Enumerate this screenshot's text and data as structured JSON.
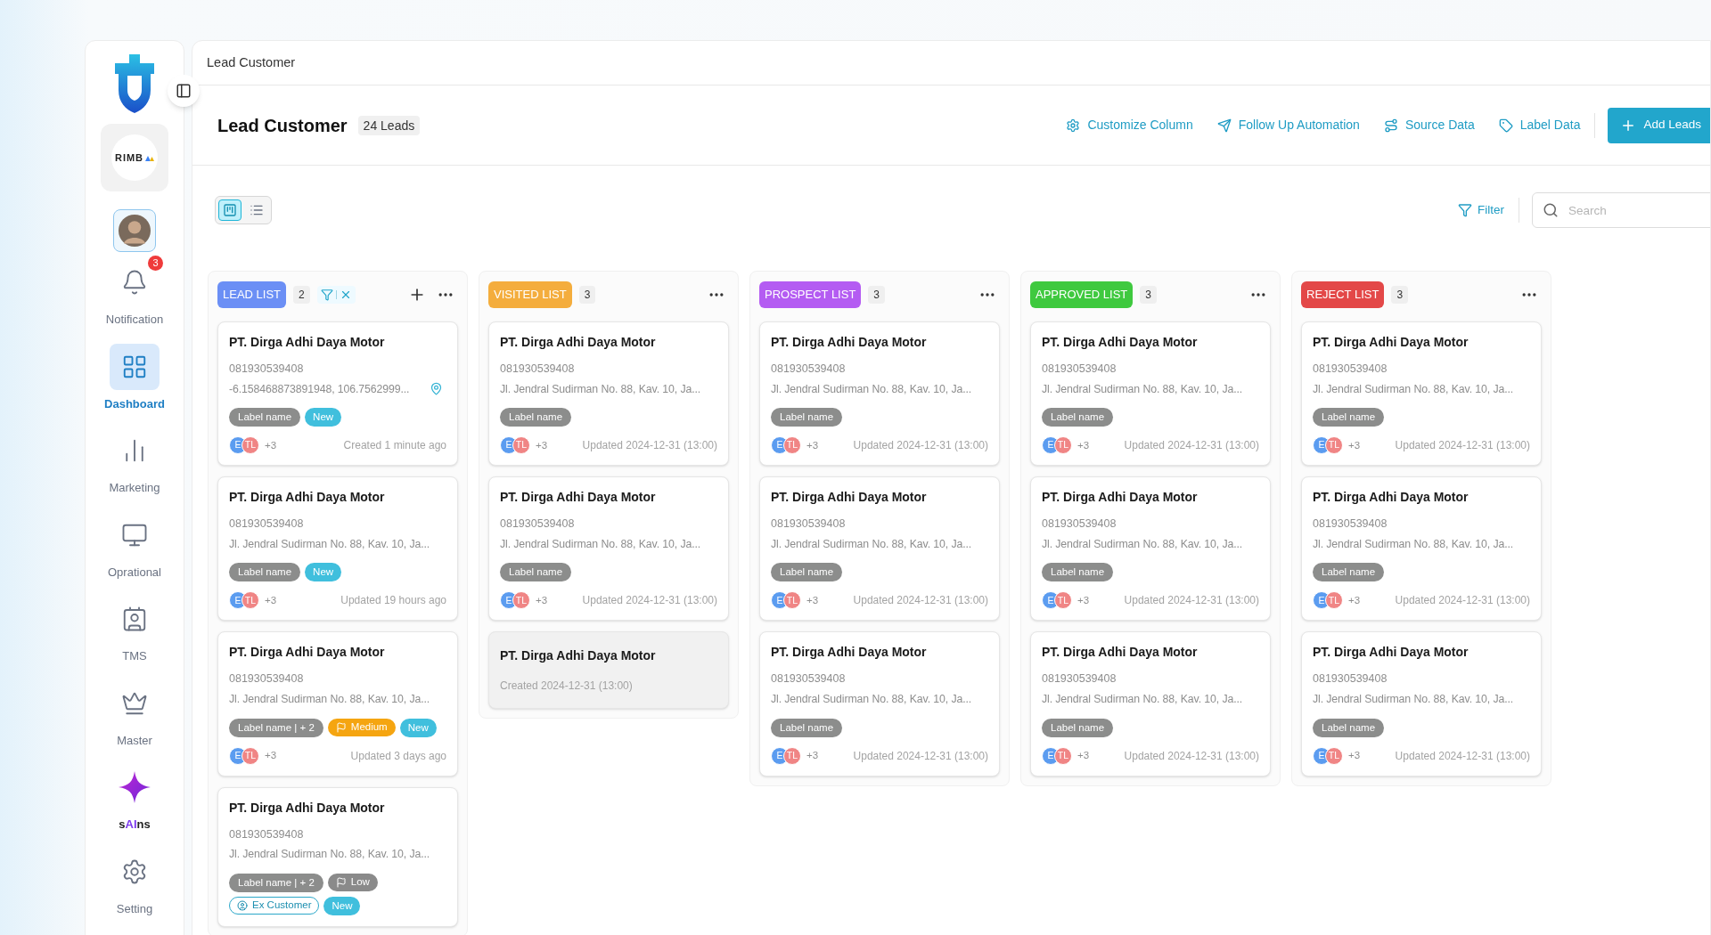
{
  "sidebar": {
    "company": "RIMB",
    "items": [
      {
        "kind": "notification",
        "label": "Notification",
        "selected": false,
        "badge": "3"
      },
      {
        "kind": "dashboard",
        "label": "Dashboard",
        "selected": true
      },
      {
        "kind": "marketing",
        "label": "Marketing",
        "selected": false
      },
      {
        "kind": "operational",
        "label": "Oprational",
        "selected": false
      },
      {
        "kind": "tms",
        "label": "TMS",
        "selected": false
      },
      {
        "kind": "master",
        "label": "Master",
        "selected": false
      },
      {
        "kind": "ai",
        "label": "s**AI**ns",
        "selected": false
      },
      {
        "kind": "setting",
        "label": "Setting",
        "selected": false
      }
    ]
  },
  "breadcrumb": "Lead Customer",
  "header": {
    "title": "Lead Customer",
    "count": "24 Leads",
    "actions": [
      {
        "kind": "customize",
        "label": "Customize Column"
      },
      {
        "kind": "automation",
        "label": "Follow Up Automation"
      },
      {
        "kind": "source",
        "label": "Source Data"
      },
      {
        "kind": "label",
        "label": "Label Data"
      }
    ],
    "primary": "Add Leads"
  },
  "views": [
    {
      "kind": "kanban",
      "selected": true
    },
    {
      "kind": "table",
      "selected": false
    }
  ],
  "filter": "Filter",
  "search": {
    "placeholder": "Search"
  },
  "columns": [
    {
      "title": "LEAD LIST",
      "color": "#6b8ff5",
      "count": "2",
      "filter_active": true,
      "can_add": true,
      "cards": [
        {
          "kind": "full",
          "name": "PT. Dirga Adhi Daya Motor",
          "phone": "081930539408",
          "address": "-6.158468873891948, 106.7562999...",
          "pin": true,
          "tags": [
            {
              "kind": "label",
              "text": "Label name"
            },
            {
              "kind": "status",
              "text": "New"
            }
          ],
          "avatars": [
            {
              "text": "E",
              "color": "#5b9cf0"
            },
            {
              "text": "TL",
              "color": "#f08585"
            }
          ],
          "more": "+3",
          "time": "Created 1 minute ago"
        },
        {
          "kind": "full",
          "name": "PT. Dirga Adhi Daya Motor",
          "phone": "081930539408",
          "address": "Jl. Jendral Sudirman No. 88, Kav. 10, Ja...",
          "pin": false,
          "tags": [
            {
              "kind": "label",
              "text": "Label name"
            },
            {
              "kind": "status",
              "text": "New"
            }
          ],
          "avatars": [
            {
              "text": "E",
              "color": "#5b9cf0"
            },
            {
              "text": "TL",
              "color": "#f08585"
            }
          ],
          "more": "+3",
          "time": "Updated 19 hours ago"
        },
        {
          "kind": "full",
          "name": "PT. Dirga Adhi Daya Motor",
          "phone": "081930539408",
          "address": "Jl. Jendral Sudirman No. 88, Kav. 10, Ja...",
          "pin": false,
          "tags": [
            {
              "kind": "label",
              "text": "Label name | + 2"
            },
            {
              "kind": "priority",
              "text": "Medium",
              "color": "#f5a511"
            },
            {
              "kind": "status",
              "text": "New"
            }
          ],
          "avatars": [
            {
              "text": "E",
              "color": "#5b9cf0"
            },
            {
              "text": "TL",
              "color": "#f08585"
            }
          ],
          "more": "+3",
          "time": "Updated 3 days ago"
        },
        {
          "kind": "full",
          "name": "PT. Dirga Adhi Daya Motor",
          "phone": "081930539408",
          "address": "Jl. Jendral Sudirman No. 88, Kav. 10, Ja...",
          "pin": false,
          "tags": [
            {
              "kind": "label",
              "text": "Label name | + 2"
            },
            {
              "kind": "priority",
              "text": "Low",
              "color": "#8a8a8a"
            },
            {
              "kind": "customer",
              "text": "Ex Customer"
            },
            {
              "kind": "status",
              "text": "New"
            }
          ]
        }
      ]
    },
    {
      "title": "VISITED LIST",
      "color": "#f4ad3d",
      "count": "3",
      "filter_active": false,
      "can_add": false,
      "cards": [
        {
          "kind": "full",
          "name": "PT. Dirga Adhi Daya Motor",
          "phone": "081930539408",
          "address": "Jl. Jendral Sudirman No. 88, Kav. 10, Ja...",
          "pin": false,
          "tags": [
            {
              "kind": "label",
              "text": "Label name"
            }
          ],
          "avatars": [
            {
              "text": "E",
              "color": "#5b9cf0"
            },
            {
              "text": "TL",
              "color": "#f08585"
            }
          ],
          "more": "+3",
          "time": "Updated 2024-12-31 (13:00)"
        },
        {
          "kind": "full",
          "name": "PT. Dirga Adhi Daya Motor",
          "phone": "081930539408",
          "address": "Jl. Jendral Sudirman No. 88, Kav. 10, Ja...",
          "pin": false,
          "tags": [
            {
              "kind": "label",
              "text": "Label name"
            }
          ],
          "avatars": [
            {
              "text": "E",
              "color": "#5b9cf0"
            },
            {
              "text": "TL",
              "color": "#f08585"
            }
          ],
          "more": "+3",
          "time": "Updated 2024-12-31 (13:00)"
        },
        {
          "kind": "compact",
          "name": "PT. Dirga Adhi Daya Motor",
          "time": "Created 2024-12-31 (13:00)"
        }
      ]
    },
    {
      "title": "PROSPECT LIST",
      "color": "#b45cf2",
      "count": "3",
      "filter_active": false,
      "can_add": false,
      "cards": [
        {
          "kind": "full",
          "name": "PT. Dirga Adhi Daya Motor",
          "phone": "081930539408",
          "address": "Jl. Jendral Sudirman No. 88, Kav. 10, Ja...",
          "pin": false,
          "tags": [
            {
              "kind": "label",
              "text": "Label name"
            }
          ],
          "avatars": [
            {
              "text": "E",
              "color": "#5b9cf0"
            },
            {
              "text": "TL",
              "color": "#f08585"
            }
          ],
          "more": "+3",
          "time": "Updated 2024-12-31 (13:00)"
        },
        {
          "kind": "full",
          "name": "PT. Dirga Adhi Daya Motor",
          "phone": "081930539408",
          "address": "Jl. Jendral Sudirman No. 88, Kav. 10, Ja...",
          "pin": false,
          "tags": [
            {
              "kind": "label",
              "text": "Label name"
            }
          ],
          "avatars": [
            {
              "text": "E",
              "color": "#5b9cf0"
            },
            {
              "text": "TL",
              "color": "#f08585"
            }
          ],
          "more": "+3",
          "time": "Updated 2024-12-31 (13:00)"
        },
        {
          "kind": "full",
          "name": "PT. Dirga Adhi Daya Motor",
          "phone": "081930539408",
          "address": "Jl. Jendral Sudirman No. 88, Kav. 10, Ja...",
          "pin": false,
          "tags": [
            {
              "kind": "label",
              "text": "Label name"
            }
          ],
          "avatars": [
            {
              "text": "E",
              "color": "#5b9cf0"
            },
            {
              "text": "TL",
              "color": "#f08585"
            }
          ],
          "more": "+3",
          "time": "Updated 2024-12-31 (13:00)"
        }
      ]
    },
    {
      "title": "APPROVED LIST",
      "color": "#3fc93f",
      "count": "3",
      "filter_active": false,
      "can_add": false,
      "cards": [
        {
          "kind": "full",
          "name": "PT. Dirga Adhi Daya Motor",
          "phone": "081930539408",
          "address": "Jl. Jendral Sudirman No. 88, Kav. 10, Ja...",
          "pin": false,
          "tags": [
            {
              "kind": "label",
              "text": "Label name"
            }
          ],
          "avatars": [
            {
              "text": "E",
              "color": "#5b9cf0"
            },
            {
              "text": "TL",
              "color": "#f08585"
            }
          ],
          "more": "+3",
          "time": "Updated 2024-12-31 (13:00)"
        },
        {
          "kind": "full",
          "name": "PT. Dirga Adhi Daya Motor",
          "phone": "081930539408",
          "address": "Jl. Jendral Sudirman No. 88, Kav. 10, Ja...",
          "pin": false,
          "tags": [
            {
              "kind": "label",
              "text": "Label name"
            }
          ],
          "avatars": [
            {
              "text": "E",
              "color": "#5b9cf0"
            },
            {
              "text": "TL",
              "color": "#f08585"
            }
          ],
          "more": "+3",
          "time": "Updated 2024-12-31 (13:00)"
        },
        {
          "kind": "full",
          "name": "PT. Dirga Adhi Daya Motor",
          "phone": "081930539408",
          "address": "Jl. Jendral Sudirman No. 88, Kav. 10, Ja...",
          "pin": false,
          "tags": [
            {
              "kind": "label",
              "text": "Label name"
            }
          ],
          "avatars": [
            {
              "text": "E",
              "color": "#5b9cf0"
            },
            {
              "text": "TL",
              "color": "#f08585"
            }
          ],
          "more": "+3",
          "time": "Updated 2024-12-31 (13:00)"
        }
      ]
    },
    {
      "title": "REJECT LIST",
      "color": "#e34848",
      "count": "3",
      "filter_active": false,
      "can_add": false,
      "cards": [
        {
          "kind": "full",
          "name": "PT. Dirga Adhi Daya Motor",
          "phone": "081930539408",
          "address": "Jl. Jendral Sudirman No. 88, Kav. 10, Ja...",
          "pin": false,
          "tags": [
            {
              "kind": "label",
              "text": "Label name"
            }
          ],
          "avatars": [
            {
              "text": "E",
              "color": "#5b9cf0"
            },
            {
              "text": "TL",
              "color": "#f08585"
            }
          ],
          "more": "+3",
          "time": "Updated 2024-12-31 (13:00)"
        },
        {
          "kind": "full",
          "name": "PT. Dirga Adhi Daya Motor",
          "phone": "081930539408",
          "address": "Jl. Jendral Sudirman No. 88, Kav. 10, Ja...",
          "pin": false,
          "tags": [
            {
              "kind": "label",
              "text": "Label name"
            }
          ],
          "avatars": [
            {
              "text": "E",
              "color": "#5b9cf0"
            },
            {
              "text": "TL",
              "color": "#f08585"
            }
          ],
          "more": "+3",
          "time": "Updated 2024-12-31 (13:00)"
        },
        {
          "kind": "full",
          "name": "PT. Dirga Adhi Daya Motor",
          "phone": "081930539408",
          "address": "Jl. Jendral Sudirman No. 88, Kav. 10, Ja...",
          "pin": false,
          "tags": [
            {
              "kind": "label",
              "text": "Label name"
            }
          ],
          "avatars": [
            {
              "text": "E",
              "color": "#5b9cf0"
            },
            {
              "text": "TL",
              "color": "#f08585"
            }
          ],
          "more": "+3",
          "time": "Updated 2024-12-31 (13:00)"
        }
      ]
    }
  ]
}
